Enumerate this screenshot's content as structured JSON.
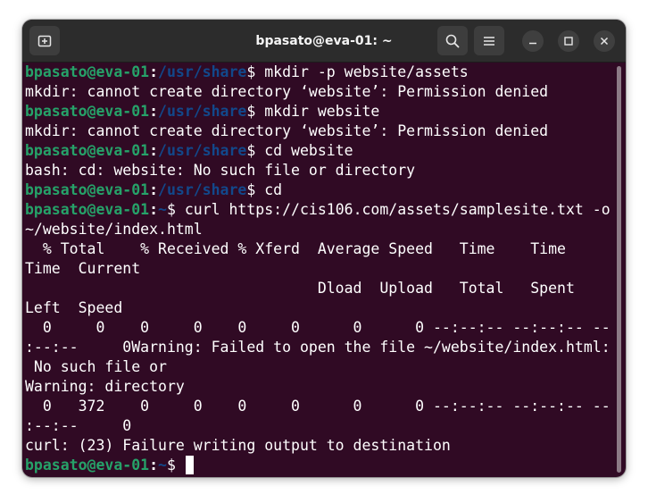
{
  "window": {
    "title": "bpasato@eva-01: ~"
  },
  "titlebar": {
    "new_tab_icon": "new-tab-icon",
    "search_icon": "search-icon",
    "menu_icon": "hamburger-menu-icon",
    "minimize_icon": "minimize-icon",
    "maximize_icon": "maximize-icon",
    "close_icon": "close-icon"
  },
  "colors": {
    "background": "#300a24",
    "prompt_user": "#26a269",
    "prompt_path": "#12488b",
    "text": "#ffffff"
  },
  "terminal": {
    "lines": [
      {
        "user": "bpasato@eva-01",
        "path": "/usr/share",
        "cmd": "$ mkdir -p website/assets"
      },
      {
        "text": "mkdir: cannot create directory ‘website’: Permission denied"
      },
      {
        "user": "bpasato@eva-01",
        "path": "/usr/share",
        "cmd": "$ mkdir website"
      },
      {
        "text": "mkdir: cannot create directory ‘website’: Permission denied"
      },
      {
        "user": "bpasato@eva-01",
        "path": "/usr/share",
        "cmd": "$ cd website"
      },
      {
        "text": "bash: cd: website: No such file or directory"
      },
      {
        "user": "bpasato@eva-01",
        "path": "/usr/share",
        "cmd": "$ cd"
      },
      {
        "user": "bpasato@eva-01",
        "path": "~",
        "cmd": "$ curl https://cis106.com/assets/samplesite.txt -o"
      },
      {
        "text": "~/website/index.html"
      },
      {
        "text": "  % Total    % Received % Xferd  Average Speed   Time    Time"
      },
      {
        "text": "Time  Current"
      },
      {
        "text": "                                 Dload  Upload   Total   Spent"
      },
      {
        "text": "Left  Speed"
      },
      {
        "text": "  0     0    0     0    0     0      0      0 --:--:-- --:--:-- --"
      },
      {
        "text": ":--:--     0Warning: Failed to open the file ~/website/index.html:"
      },
      {
        "text": " No such file or"
      },
      {
        "text": "Warning: directory"
      },
      {
        "text": "  0   372    0     0    0     0      0      0 --:--:-- --:--:-- --"
      },
      {
        "text": ":--:--     0"
      },
      {
        "text": "curl: (23) Failure writing output to destination"
      },
      {
        "user": "bpasato@eva-01",
        "path": "~",
        "cmd": "$ ",
        "cursor": true
      }
    ]
  }
}
